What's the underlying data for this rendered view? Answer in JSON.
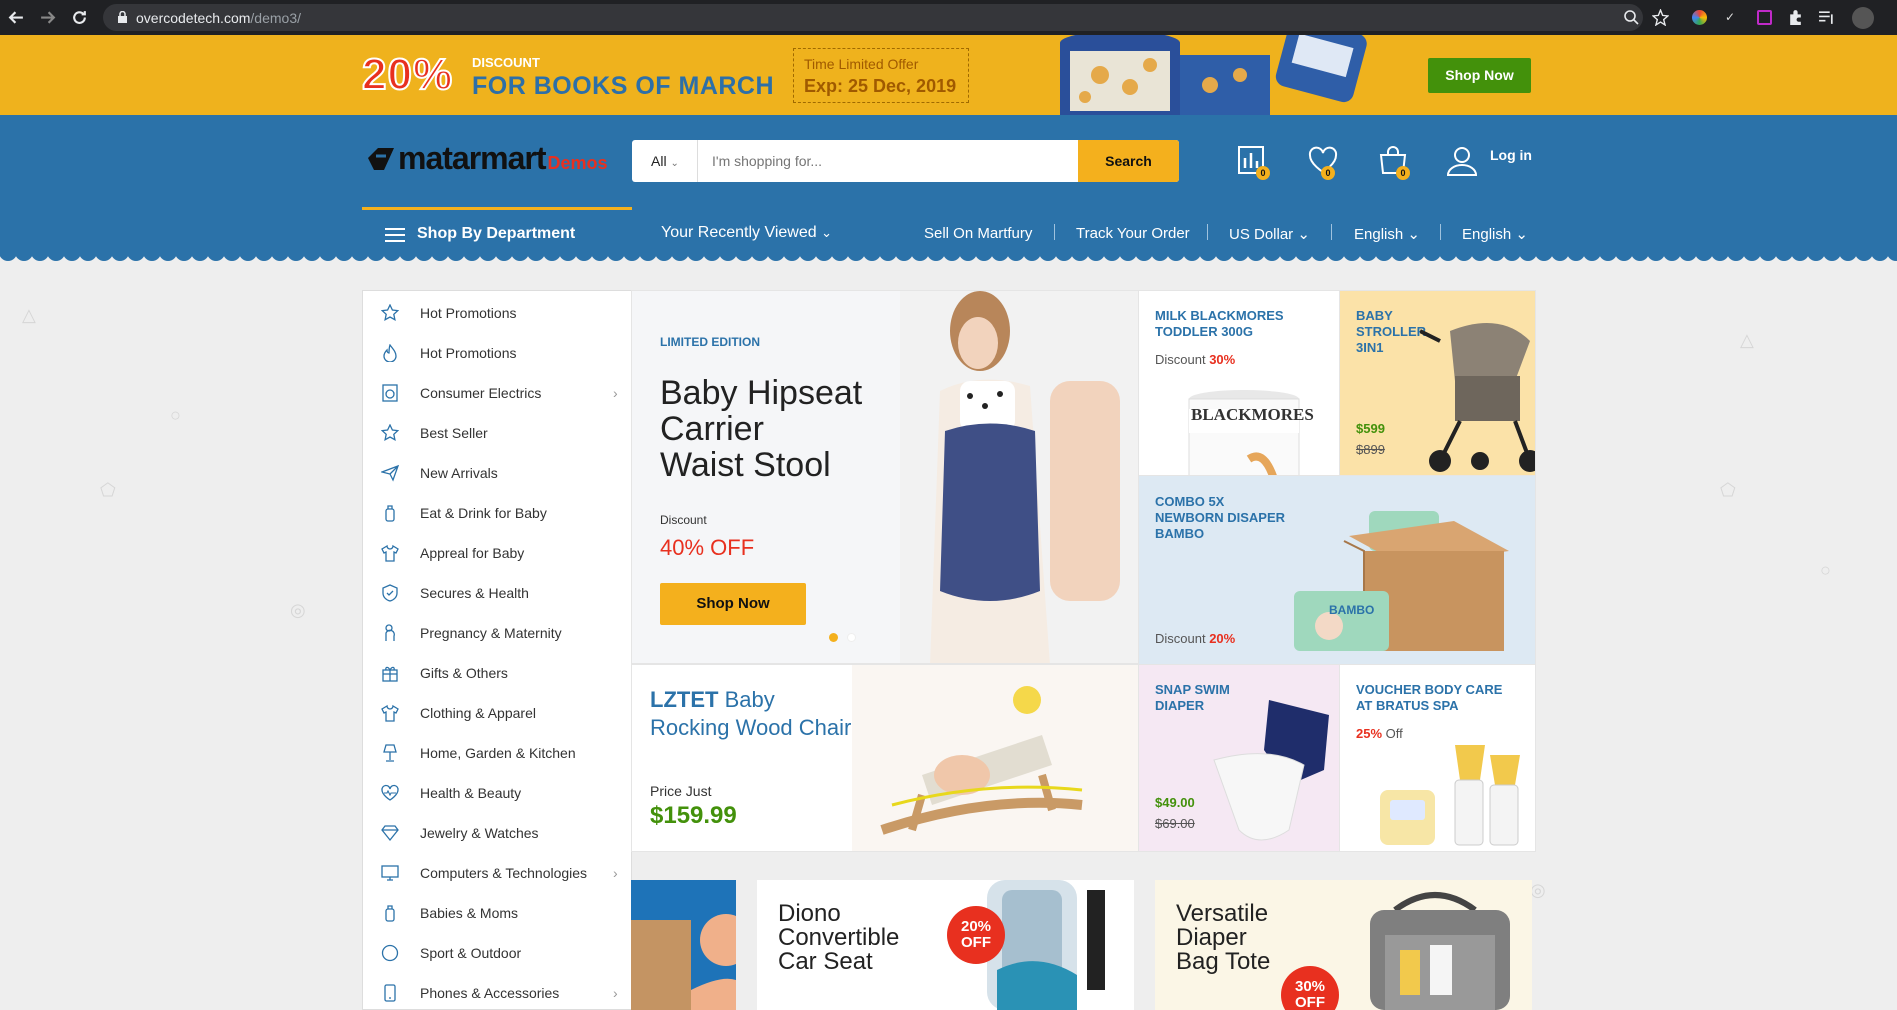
{
  "browser": {
    "url_domain": "overcodetech.com",
    "url_path": "/demo3/"
  },
  "promo": {
    "percent": "20%",
    "discount_label": "DISCOUNT",
    "headline": "FOR BOOKS OF MARCH",
    "limited_line1": "Time Limited Offer",
    "limited_line2": "Exp: 25 Dec, 2019",
    "button": "Shop Now"
  },
  "header": {
    "logo_text": "matarmart",
    "logo_suffix": "Demos",
    "search_category": "All",
    "search_placeholder": "I'm shopping for...",
    "search_button": "Search",
    "compare_count": "0",
    "wishlist_count": "0",
    "cart_count": "0",
    "login": "Log in"
  },
  "navbar": {
    "department": "Shop By Department",
    "recent": "Your Recently Viewed",
    "sell": "Sell On Martfury",
    "track": "Track Your Order",
    "currency": "US Dollar",
    "language1": "English",
    "language2": "English"
  },
  "sidebar": {
    "items": [
      {
        "label": "Hot Promotions",
        "icon": "star-icon",
        "arrow": false
      },
      {
        "label": "Hot Promotions",
        "icon": "fire-icon",
        "arrow": false
      },
      {
        "label": "Consumer Electrics",
        "icon": "washer-icon",
        "arrow": true
      },
      {
        "label": "Best Seller",
        "icon": "star-icon",
        "arrow": false
      },
      {
        "label": "New Arrivals",
        "icon": "paper-plane-icon",
        "arrow": false
      },
      {
        "label": "Eat & Drink for Baby",
        "icon": "bottle-icon",
        "arrow": false
      },
      {
        "label": "Appreal for Baby",
        "icon": "shirt-icon",
        "arrow": false
      },
      {
        "label": "Secures & Health",
        "icon": "shield-icon",
        "arrow": false
      },
      {
        "label": "Pregnancy & Maternity",
        "icon": "pregnant-icon",
        "arrow": false
      },
      {
        "label": "Gifts & Others",
        "icon": "gift-icon",
        "arrow": false
      },
      {
        "label": "Clothing & Apparel",
        "icon": "shirt-icon",
        "arrow": false
      },
      {
        "label": "Home, Garden & Kitchen",
        "icon": "lamp-icon",
        "arrow": false
      },
      {
        "label": "Health & Beauty",
        "icon": "heart-pulse-icon",
        "arrow": false
      },
      {
        "label": "Jewelry & Watches",
        "icon": "diamond-icon",
        "arrow": false
      },
      {
        "label": "Computers & Technologies",
        "icon": "monitor-icon",
        "arrow": true
      },
      {
        "label": "Babies & Moms",
        "icon": "bottle-icon",
        "arrow": false
      },
      {
        "label": "Sport & Outdoor",
        "icon": "ball-icon",
        "arrow": false
      },
      {
        "label": "Phones & Accessories",
        "icon": "phone-icon",
        "arrow": true
      }
    ]
  },
  "main_banner": {
    "tag": "LIMITED EDITION",
    "title_l1": "Baby Hipseat",
    "title_l2": "Carrier",
    "title_l3": "Waist Stool",
    "discount_label": "Discount",
    "discount_value": "40% OFF",
    "button": "Shop Now"
  },
  "tiles": {
    "milk": {
      "title_l1": "MILK BLACKMORES",
      "title_l2": "TODDLER 300G",
      "disc_label": "Discount",
      "disc_value": "30%",
      "brand": "BLACKMORES"
    },
    "stroller": {
      "title_l1": "BABY",
      "title_l2": "STROLLER",
      "title_l3": "3IN1",
      "price": "$599",
      "old_price": "$899"
    },
    "combo": {
      "title_l1": "COMBO 5X",
      "title_l2": "NEWBORN DISAPER",
      "title_l3": "BAMBO",
      "disc_label": "Discount",
      "disc_value": "20%",
      "brand": "BAMBO"
    },
    "chair": {
      "brand": "LZTET",
      "title_l1": "Baby",
      "title_l2": "Rocking Wood Chair",
      "price_label": "Price Just",
      "price": "$159.99"
    },
    "swim": {
      "title_l1": "SNAP SWIM",
      "title_l2": "DIAPER",
      "price": "$49.00",
      "old_price": "$69.00"
    },
    "voucher": {
      "title_l1": "VOUCHER BODY CARE",
      "title_l2": "AT BRATUS SPA",
      "disc_value": "25%",
      "disc_label": "Off"
    }
  },
  "bottom": {
    "seat": {
      "title_l1": "Diono",
      "title_l2": "Convertible",
      "title_l3": "Car Seat",
      "badge_l1": "20%",
      "badge_l2": "OFF"
    },
    "tote": {
      "title_l1": "Versatile",
      "title_l2": "Diaper",
      "title_l3": "Bag Tote",
      "badge_l1": "30%",
      "badge_l2": "OFF"
    }
  },
  "colors": {
    "brand_blue": "#2b72a9",
    "accent_yellow": "#f4b01d",
    "sale_red": "#e8301f",
    "price_green": "#43910b"
  }
}
